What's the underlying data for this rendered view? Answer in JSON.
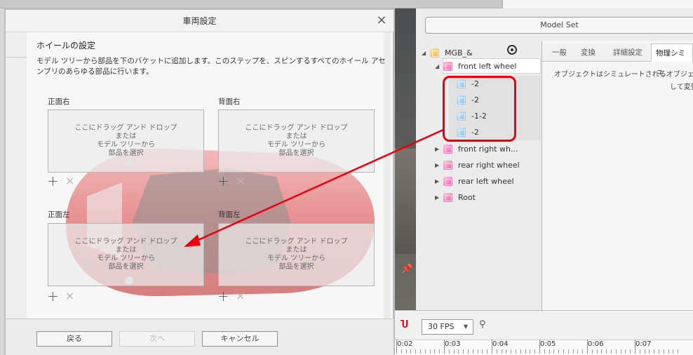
{
  "dialog": {
    "title": "車両設定",
    "section_title": "ホイールの設定",
    "instructions": "モデル ツリーから部品を下のバケットに追加します。このステップを、スピンするすべてのホイール アセンブリのあらゆる部品に行います。",
    "slots": [
      {
        "label": "正面右",
        "drop_text": [
          "ここにドラッグ アンド ドロップ",
          "または",
          "モデル ツリーから",
          "部品を選択"
        ]
      },
      {
        "label": "背面右",
        "drop_text": [
          "ここにドラッグ アンド ドロップ",
          "または",
          "モデル ツリーから",
          "部品を選択"
        ]
      },
      {
        "label": "正面左",
        "drop_text": [
          "ここにドラッグ アンド ドロップ",
          "または",
          "モデル ツリーから",
          "部品を選択"
        ]
      },
      {
        "label": "背面左",
        "drop_text": [
          "ここにドラッグ アンド ドロップ",
          "または",
          "モデル ツリーから",
          "部品を選択"
        ]
      }
    ],
    "add_symbol": "+",
    "remove_symbol": "×",
    "buttons": {
      "back": "戻る",
      "next": "次へ",
      "cancel": "キャンセル"
    },
    "close_symbol": "×"
  },
  "right_panel": {
    "model_set_label": "Model Set",
    "tree": [
      {
        "label": "MGB_&",
        "icon": "assembly-cube-yellow-icon"
      },
      {
        "label": "front left wheel",
        "icon": "part-cube-pink-icon"
      },
      {
        "label": "-2",
        "icon": "part-cube-blue-icon"
      },
      {
        "label": "-2",
        "icon": "part-cube-blue-icon"
      },
      {
        "label": "-1-2",
        "icon": "part-cube-blue-icon"
      },
      {
        "label": "-2",
        "icon": "part-cube-blue-icon"
      },
      {
        "label": "front right wh...",
        "icon": "part-cube-pink-icon"
      },
      {
        "label": "rear right wheel",
        "icon": "part-cube-pink-icon"
      },
      {
        "label": "rear left wheel",
        "icon": "part-cube-pink-icon"
      },
      {
        "label": "Root",
        "icon": "part-cube-pink-icon"
      }
    ],
    "tabs": [
      "一般",
      "変換",
      "詳細設定",
      "物理シミュ"
    ],
    "description_line1": "オブジェクトはシミュレートされるオブジェクトの",
    "description_line2": "して変更で"
  },
  "timeline": {
    "fps": "30 FPS",
    "ticks": [
      "0:02",
      "0:03",
      "0:04",
      "0:05",
      "0:06",
      "0:07"
    ]
  },
  "colors": {
    "annotation_red": "#e8000e",
    "accent": "#e56aa7"
  }
}
